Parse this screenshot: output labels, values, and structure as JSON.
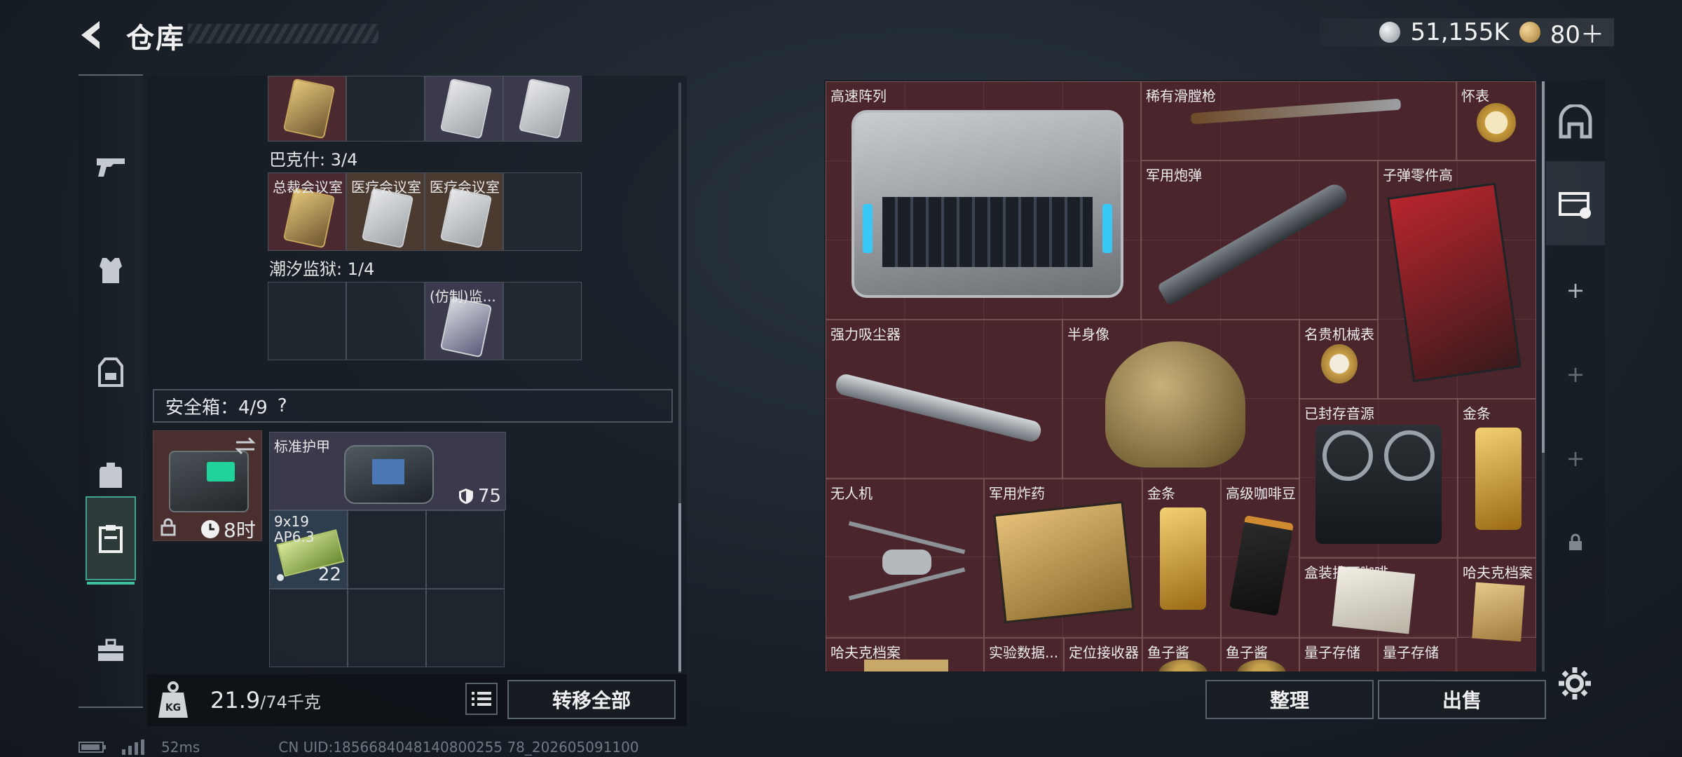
{
  "header": {
    "title": "仓库",
    "currency": [
      {
        "icon": "silver-coin-icon",
        "value": "51,155K"
      },
      {
        "icon": "gold-coin-icon",
        "value": "80＋"
      }
    ]
  },
  "categories": [
    {
      "icon": "gun-icon",
      "selected": false
    },
    {
      "icon": "armor-vest-icon",
      "selected": false
    },
    {
      "icon": "chest-rig-icon",
      "selected": false
    },
    {
      "icon": "backpack-icon",
      "selected": false
    },
    {
      "icon": "clipboard-icon",
      "selected": true
    },
    {
      "icon": "toolbox-icon",
      "selected": false
    }
  ],
  "keycards": {
    "top_row_label": "",
    "bakshi": {
      "label": "巴克什: 3/4",
      "cards": [
        "总裁会议室",
        "医疗会议室",
        "医疗会议室"
      ]
    },
    "tidal_prison": {
      "label": "潮汐监狱: 1/4",
      "cards": [
        "(仿制)监..."
      ]
    }
  },
  "safe_box": {
    "label": "安全箱：4/9",
    "help": "?",
    "timer": "8时",
    "armor": {
      "name": "标准护甲",
      "durability": "75"
    },
    "ammo": {
      "name": "9x19 AP6.3",
      "line1": "9x19",
      "line2": "AP6.3",
      "qty": "22"
    }
  },
  "weight": {
    "current": "21.9",
    "max": "/74千克"
  },
  "buttons": {
    "transfer_all": "转移全部",
    "sort": "整理",
    "sell": "出售"
  },
  "stash_items": [
    {
      "id": "server-array",
      "label": "高速阵列"
    },
    {
      "id": "flintlock",
      "label": "稀有滑膛枪"
    },
    {
      "id": "pocket-watch",
      "label": "怀表"
    },
    {
      "id": "artillery-shell",
      "label": "军用炮弹"
    },
    {
      "id": "bullet-parts",
      "label": "子弹零件高"
    },
    {
      "id": "vacuum",
      "label": "强力吸尘器"
    },
    {
      "id": "bust",
      "label": "半身像"
    },
    {
      "id": "mech-watch",
      "label": "名贵机械表"
    },
    {
      "id": "tape-recorder",
      "label": "已封存音源"
    },
    {
      "id": "gold-bar-1",
      "label": "金条"
    },
    {
      "id": "drone",
      "label": "无人机"
    },
    {
      "id": "explosives",
      "label": "军用炸药"
    },
    {
      "id": "gold-bar-2",
      "label": "金条"
    },
    {
      "id": "coffee",
      "label": "高级咖啡豆"
    },
    {
      "id": "boxed-coffee",
      "label": "盒装挂耳咖啡"
    },
    {
      "id": "file-1",
      "label": "哈夫克档案"
    },
    {
      "id": "file-2",
      "label": "哈夫克档案"
    },
    {
      "id": "data",
      "label": "实验数据..."
    },
    {
      "id": "receiver",
      "label": "定位接收器"
    },
    {
      "id": "caviar-1",
      "label": "鱼子酱"
    },
    {
      "id": "caviar-2",
      "label": "鱼子酱"
    },
    {
      "id": "storage-1",
      "label": "量子存储"
    },
    {
      "id": "storage-2",
      "label": "量子存储"
    }
  ],
  "status": {
    "ping": "52ms",
    "uid": "CN UID:1856684048140800255 78_202605091100"
  },
  "colors": {
    "accent": "#3fc29b",
    "stash_bg": "#4a262c",
    "safe_slot": "#3a3a4c"
  }
}
